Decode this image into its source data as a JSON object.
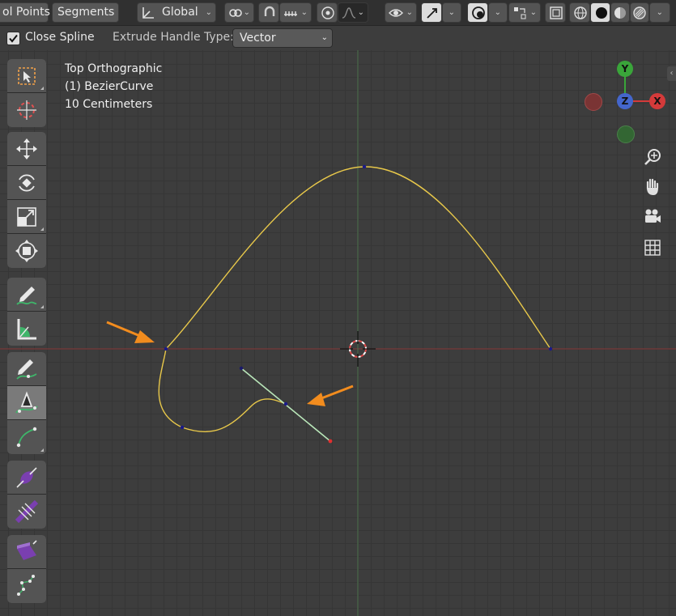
{
  "header": {
    "control_points_tab": "ol Points",
    "segments_tab": "Segments",
    "transform_orientation": "Global"
  },
  "tool_settings": {
    "close_spline_label": "Close Spline",
    "close_spline_checked": true,
    "extrude_handle_label": "Extrude Handle Type:",
    "extrude_handle_value": "Vector"
  },
  "viewport": {
    "view_name": "Top Orthographic",
    "object_name": "(1) BezierCurve",
    "scale_text": "10 Centimeters"
  },
  "gizmo": {
    "y_label": "Y",
    "z_label": "Z",
    "x_label": "X",
    "colors": {
      "x": "#d43a3a",
      "y": "#3aa53a",
      "z": "#4466cc"
    }
  },
  "colors": {
    "curve": "#e8c84a",
    "handle": "#b9e6b9",
    "annotation_arrow": "#f28c1e",
    "x_axis_line": "#7a3a3a",
    "y_axis_line": "#4a6a4a"
  },
  "toolbar": {
    "tools": [
      "select-box",
      "cursor",
      "move",
      "rotate",
      "scale",
      "transform",
      "annotate",
      "measure",
      "draw",
      "pen",
      "curve-pen",
      "radius",
      "tilt",
      "extrude",
      "randomize"
    ]
  }
}
